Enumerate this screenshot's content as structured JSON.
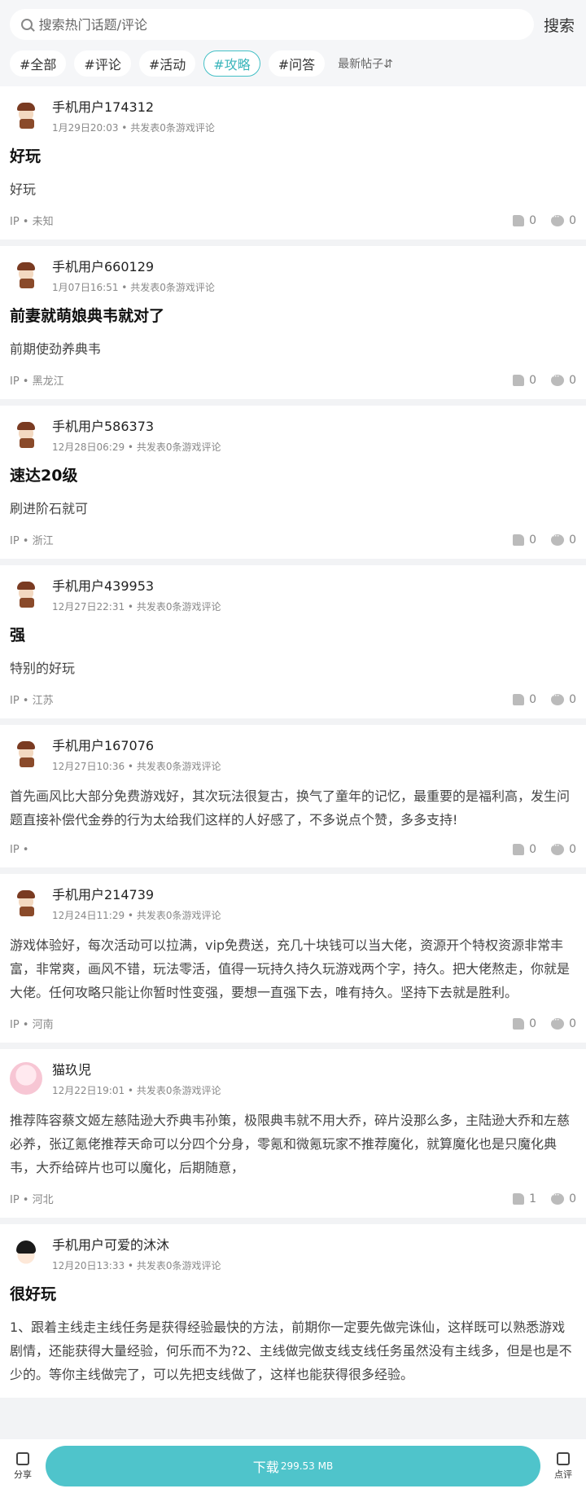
{
  "search": {
    "placeholder": "搜索热门话题/评论",
    "button": "搜索"
  },
  "filters": [
    "#全部",
    "#评论",
    "#活动",
    "#攻略",
    "#问答"
  ],
  "active_filter": "#攻略",
  "sort_label": "最新帖子⇵",
  "posts": [
    {
      "user": "手机用户174312",
      "meta": "1月29日20:03 • 共发表0条游戏评论",
      "title": "好玩",
      "body": "好玩",
      "ip": "IP • 未知",
      "likes": "0",
      "comments": "0",
      "avatar": "pirate"
    },
    {
      "user": "手机用户660129",
      "meta": "1月07日16:51 • 共发表0条游戏评论",
      "title": "前妻就萌娘典韦就对了",
      "body": "前期使劲养典韦",
      "ip": "IP • 黑龙江",
      "likes": "0",
      "comments": "0",
      "avatar": "pirate"
    },
    {
      "user": "手机用户586373",
      "meta": "12月28日06:29 • 共发表0条游戏评论",
      "title": "速达20级",
      "body": "刷进阶石就可",
      "ip": "IP • 浙江",
      "likes": "0",
      "comments": "0",
      "avatar": "pirate"
    },
    {
      "user": "手机用户439953",
      "meta": "12月27日22:31 • 共发表0条游戏评论",
      "title": "强",
      "body": "特别的好玩",
      "ip": "IP • 江苏",
      "likes": "0",
      "comments": "0",
      "avatar": "pirate"
    },
    {
      "user": "手机用户167076",
      "meta": "12月27日10:36 • 共发表0条游戏评论",
      "title": "",
      "body": "首先画风比大部分免费游戏好，其次玩法很复古，换气了童年的记忆，最重要的是福利高，发生问题直接补偿代金券的行为太给我们这样的人好感了，不多说点个赞，多多支持!",
      "ip": "IP •",
      "likes": "0",
      "comments": "0",
      "avatar": "pirate"
    },
    {
      "user": "手机用户214739",
      "meta": "12月24日11:29 • 共发表0条游戏评论",
      "title": "",
      "body": "游戏体验好，每次活动可以拉满，vip免费送，充几十块钱可以当大佬，资源开个特权资源非常丰富，非常爽，画风不错，玩法零活，值得一玩持久持久玩游戏两个字，持久。把大佬熬走，你就是大佬。任何攻略只能让你暂时性变强，要想一直强下去，唯有持久。坚持下去就是胜利。",
      "ip": "IP • 河南",
      "likes": "0",
      "comments": "0",
      "avatar": "pirate"
    },
    {
      "user": "猫玖児",
      "meta": "12月22日19:01 • 共发表0条游戏评论",
      "title": "",
      "body": "推荐阵容蔡文姬左慈陆逊大乔典韦孙策，极限典韦就不用大乔，碎片没那么多，主陆逊大乔和左慈必养，张辽氪佬推荐天命可以分四个分身，零氪和微氪玩家不推荐魔化，就算魔化也是只魔化典韦，大乔给碎片也可以魔化，后期随意，",
      "ip": "IP • 河北",
      "likes": "1",
      "comments": "0",
      "avatar": "pink"
    },
    {
      "user": "手机用户可爱的沐沐",
      "meta": "12月20日13:33 • 共发表0条游戏评论",
      "title": "很好玩",
      "body": "1、跟着主线走主线任务是获得经验最快的方法，前期你一定要先做完诛仙，这样既可以熟悉游戏剧情，还能获得大量经验，何乐而不为?2、主线做完做支线支线任务虽然没有主线多，但是也是不少的。等你主线做完了，可以先把支线做了，这样也能获得很多经验。",
      "ip": "",
      "likes": "",
      "comments": "",
      "avatar": "black"
    }
  ],
  "bottom": {
    "share": "分享",
    "download": "下载",
    "size": "299.53 MB",
    "review": "点评"
  }
}
